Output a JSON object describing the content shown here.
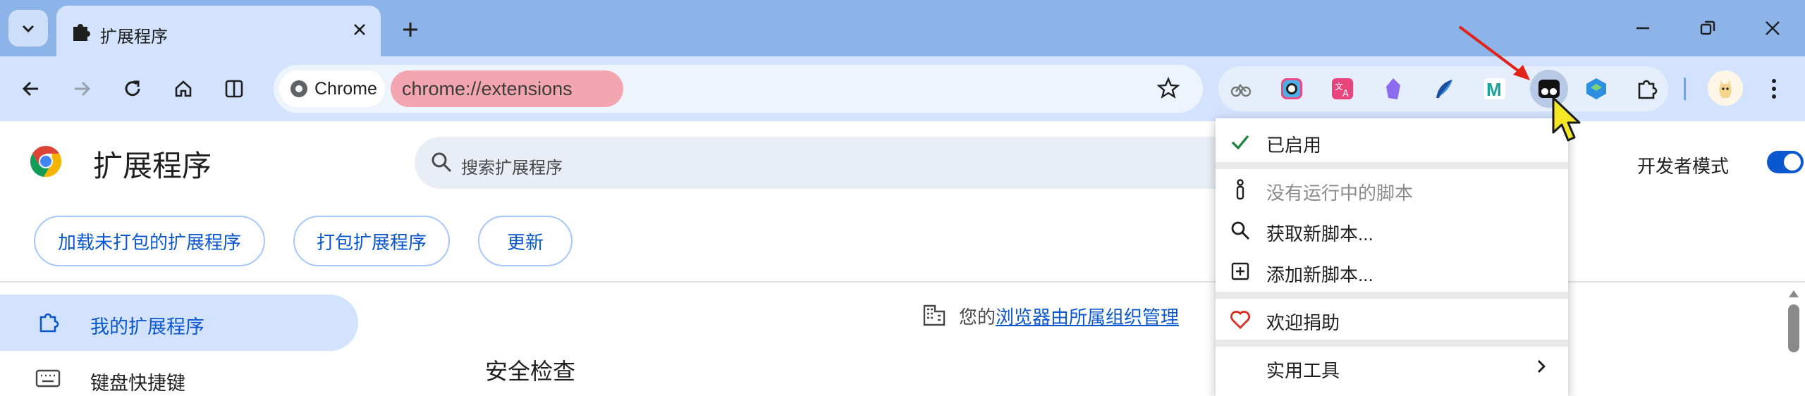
{
  "tab": {
    "title": "扩展程序"
  },
  "omnibox": {
    "chip_label": "Chrome",
    "url": "chrome://extensions"
  },
  "page": {
    "title": "扩展程序",
    "search_placeholder": "搜索扩展程序",
    "dev_mode_label": "开发者模式",
    "dev_mode_on": true,
    "buttons": [
      "加载未打包的扩展程序",
      "打包扩展程序",
      "更新"
    ],
    "sidebar": [
      {
        "label": "我的扩展程序",
        "active": true
      },
      {
        "label": "键盘快捷键",
        "active": false
      }
    ],
    "managed_prefix": "您的",
    "managed_link": "浏览器由所属组织管理",
    "section_title": "安全检查"
  },
  "menu": {
    "items": [
      {
        "label": "已启用",
        "icon": "check-icon",
        "disabled": false
      },
      {
        "label": "没有运行中的脚本",
        "icon": "info-icon",
        "disabled": true
      },
      {
        "label": "获取新脚本...",
        "icon": "search-icon",
        "disabled": false
      },
      {
        "label": "添加新脚本...",
        "icon": "plus-box-icon",
        "disabled": false
      },
      {
        "label": "欢迎捐助",
        "icon": "heart-icon",
        "disabled": false
      },
      {
        "label": "实用工具",
        "icon": "",
        "disabled": false,
        "submenu": true
      }
    ]
  },
  "colors": {
    "accent": "#0b57d0",
    "titlebar": "#8cb4e9",
    "toolbar": "#d3e3fd",
    "url_highlight": "#f3a6b0",
    "heart": "#d93025",
    "check": "#188038"
  }
}
